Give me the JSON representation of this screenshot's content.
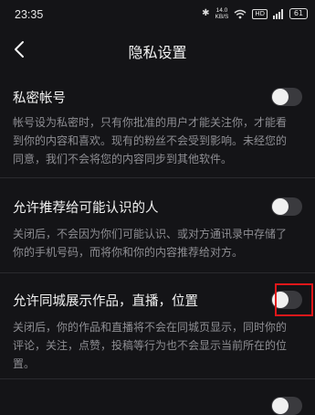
{
  "status_bar": {
    "time": "23:35",
    "net_speed_value": "14.0",
    "net_speed_unit": "KB/S",
    "hd_label": "HD",
    "battery": "61"
  },
  "header": {
    "title": "隐私设置"
  },
  "settings": [
    {
      "title": "私密帐号",
      "desc": [
        "帐号设为私密时，只有你批准的用户才能关注你，才能看",
        "到你的内容和喜欢。现有的粉丝不会受到影响。未经您的",
        "同意，我们不会将您的内容同步到其他软件。"
      ],
      "enabled": false
    },
    {
      "title": "允许推荐给可能认识的人",
      "desc": [
        "关闭后，不会因为你们可能认识、或对方通讯录中存储了",
        "你的手机号码，而将你和你的内容推荐给对方。"
      ],
      "enabled": false
    },
    {
      "title": "允许同城展示作品，直播，位置",
      "desc": [
        "关闭后，你的作品和直播将不会在同城页显示，同时你的",
        "评论，关注，点赞，投稿等行为也不会显示当前所在的位置。"
      ],
      "enabled": false
    }
  ],
  "colors": {
    "highlight": "#e0171a",
    "toggle_off": "#3a3a3e"
  }
}
